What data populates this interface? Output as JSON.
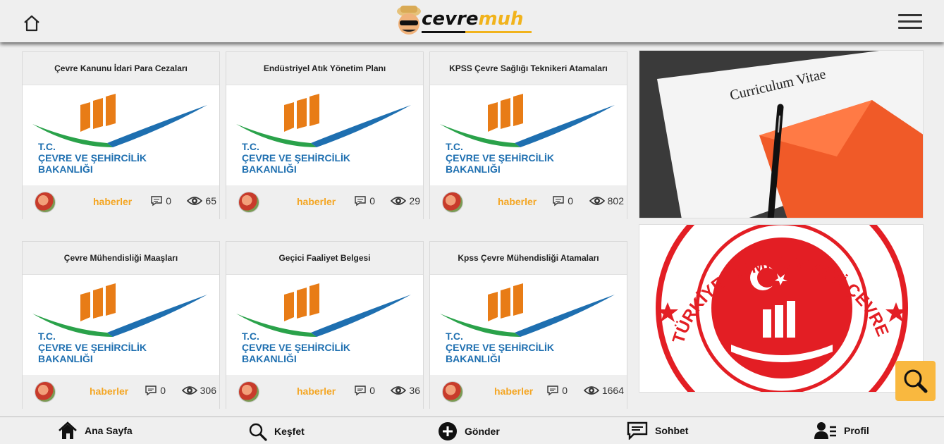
{
  "header": {
    "logo_text_dark": "cevre",
    "logo_text_accent": "muh",
    "home_icon": "home-icon",
    "menu_icon": "hamburger-menu-icon"
  },
  "posts": [
    {
      "title": "Çevre Kanunu İdari Para Cezaları",
      "ministry": [
        "T.C.",
        "ÇEVRE VE ŞEHİRCİLİK",
        "BAKANLIĞI"
      ],
      "category": "haberler",
      "comments": "0",
      "views": "65"
    },
    {
      "title": "Endüstriyel Atık Yönetim Planı",
      "ministry": [
        "T.C.",
        "ÇEVRE VE ŞEHİRCİLİK",
        "BAKANLIĞI"
      ],
      "category": "haberler",
      "comments": "0",
      "views": "29"
    },
    {
      "title": "KPSS Çevre Sağlığı Teknikeri Atamaları",
      "ministry": [
        "T.C.",
        "ÇEVRE VE ŞEHİRCİLİK",
        "BAKANLIĞI"
      ],
      "category": "haberler",
      "comments": "0",
      "views": "802"
    },
    {
      "title": "Çevre Mühendisliği Maaşları",
      "ministry": [
        "T.C.",
        "ÇEVRE VE ŞEHİRCİLİK",
        "BAKANLIĞI"
      ],
      "category": "haberler",
      "comments": "0",
      "views": "306"
    },
    {
      "title": "Geçici Faaliyet Belgesi",
      "ministry": [
        "T.C.",
        "ÇEVRE VE ŞEHİRCİLİK",
        "BAKANLIĞI"
      ],
      "category": "haberler",
      "comments": "0",
      "views": "36"
    },
    {
      "title": "Kpss Çevre Mühendisliği Atamaları",
      "ministry": [
        "T.C.",
        "ÇEVRE VE ŞEHİRCİLİK",
        "BAKANLIĞI"
      ],
      "category": "haberler",
      "comments": "0",
      "views": "1664"
    }
  ],
  "sidebar": {
    "cv_title": "Curriculum Vitae",
    "seal_text": "TÜRKİYE CUMHURİYETİ ÇEVRE VE ŞEHİRCİLİK BAKANLIĞI"
  },
  "bottom_nav": [
    {
      "label": "Ana Sayfa",
      "icon": "home-icon"
    },
    {
      "label": "Keşfet",
      "icon": "search-icon"
    },
    {
      "label": "Gönder",
      "icon": "plus-circle-icon"
    },
    {
      "label": "Sohbet",
      "icon": "chat-icon"
    },
    {
      "label": "Profil",
      "icon": "profile-icon"
    }
  ],
  "colors": {
    "accent": "#f4a623",
    "fab": "#f9b83f",
    "seal_red": "#e31e24",
    "ministry_blue": "#1e6fb0",
    "ministry_green": "#2aa24a",
    "ministry_orange": "#e87c16"
  }
}
